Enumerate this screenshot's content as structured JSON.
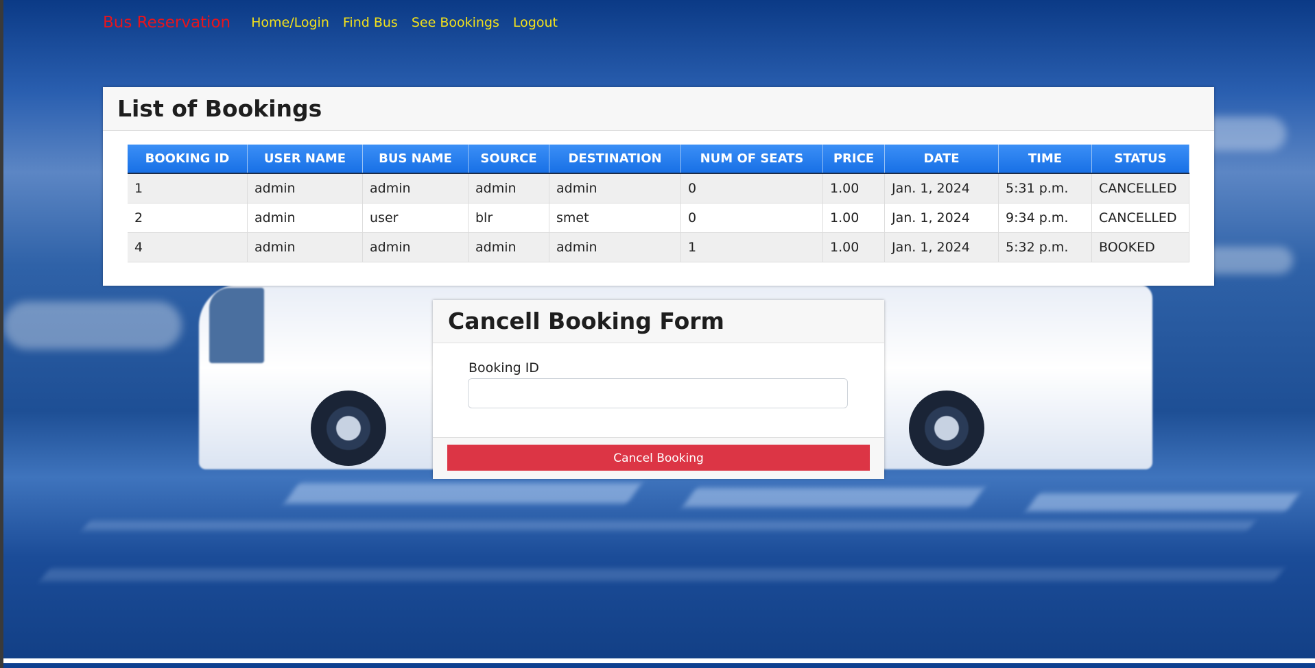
{
  "nav": {
    "brand": "Bus Reservation",
    "links": [
      "Home/Login",
      "Find Bus",
      "See Bookings",
      "Logout"
    ]
  },
  "bookings": {
    "title": "List of Bookings",
    "columns": [
      "BOOKING ID",
      "USER NAME",
      "BUS NAME",
      "SOURCE",
      "DESTINATION",
      "NUM OF SEATS",
      "PRICE",
      "DATE",
      "TIME",
      "STATUS"
    ],
    "rows": [
      [
        "1",
        "admin",
        "admin",
        "admin",
        "admin",
        "0",
        "1.00",
        "Jan. 1, 2024",
        "5:31 p.m.",
        "CANCELLED"
      ],
      [
        "2",
        "admin",
        "user",
        "blr",
        "smet",
        "0",
        "1.00",
        "Jan. 1, 2024",
        "9:34 p.m.",
        "CANCELLED"
      ],
      [
        "4",
        "admin",
        "admin",
        "admin",
        "admin",
        "1",
        "1.00",
        "Jan. 1, 2024",
        "5:32 p.m.",
        "BOOKED"
      ]
    ]
  },
  "cancel_form": {
    "title": "Cancell Booking Form",
    "field_label": "Booking ID",
    "field_value": "",
    "button_label": "Cancel Booking"
  },
  "colors": {
    "brand": "#e8141c",
    "nav_link": "#f4e21a",
    "table_header": "#1870e6",
    "cancel_button": "#dc3545"
  }
}
